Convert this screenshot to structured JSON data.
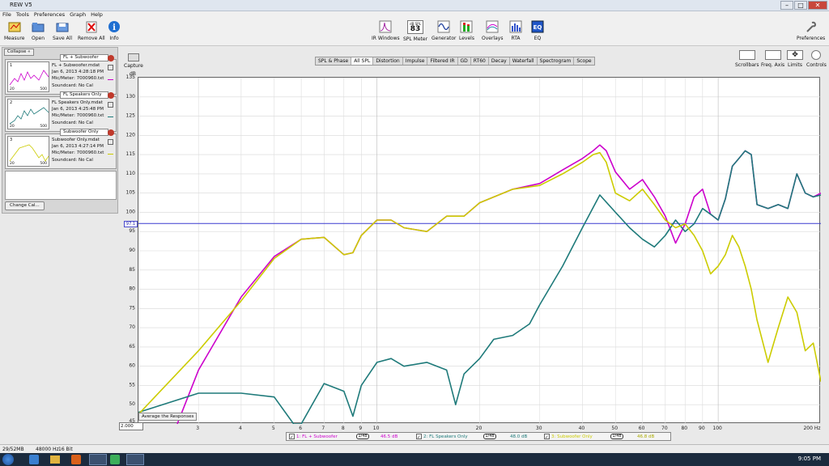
{
  "window": {
    "title": "REW V5"
  },
  "menu": [
    "File",
    "Tools",
    "Preferences",
    "Graph",
    "Help"
  ],
  "toolbar_left": [
    {
      "label": "Measure",
      "icon": "measure-icon"
    },
    {
      "label": "Open",
      "icon": "open-folder-icon"
    },
    {
      "label": "Save All",
      "icon": "save-icon"
    },
    {
      "label": "Remove All",
      "icon": "remove-icon"
    },
    {
      "label": "Info",
      "icon": "info-icon"
    }
  ],
  "toolbar_center": [
    {
      "label": "IR Windows",
      "icon": "ir-windows-icon"
    },
    {
      "label": "SPL Meter",
      "icon": "spl-meter-icon",
      "readout_unit": "dB SPL",
      "readout_value": "83"
    },
    {
      "label": "Generator",
      "icon": "generator-icon"
    },
    {
      "label": "Levels",
      "icon": "levels-icon"
    },
    {
      "label": "Overlays",
      "icon": "overlays-icon"
    },
    {
      "label": "RTA",
      "icon": "rta-icon"
    },
    {
      "label": "EQ",
      "icon": "eq-icon"
    }
  ],
  "toolbar_right": {
    "label": "Preferences",
    "icon": "wrench-icon"
  },
  "graph_tabs": {
    "items": [
      "SPL & Phase",
      "All SPL",
      "Distortion",
      "Impulse",
      "Filtered IR",
      "GD",
      "RT60",
      "Decay",
      "Waterfall",
      "Spectrogram",
      "Scope"
    ],
    "active": "All SPL"
  },
  "right_controls": [
    "Scrollbars",
    "Freq. Axis",
    "Limits",
    "Controls"
  ],
  "capture": {
    "label": "Capture"
  },
  "left_panel": {
    "collapse_label": "Collapse",
    "change_cal_label": "Change Cal...",
    "measurements": [
      {
        "num": "1",
        "tag": "FL + Subwoofer",
        "lines": [
          "FL + Subwoofer.mdat",
          "Jan 6, 2013 4:28:18 PM",
          "Mic/Meter: 7000960.txt",
          "Soundcard: No Cal"
        ],
        "color": "#cc00cc",
        "mini_min": "20",
        "mini_max": "500"
      },
      {
        "num": "2",
        "tag": "FL Speakers Only",
        "lines": [
          "FL Speakers Only.mdat",
          "Jan 6, 2013 4:25:48 PM",
          "Mic/Meter: 7000960.txt",
          "Soundcard: No Cal"
        ],
        "color": "#1e7a7a",
        "mini_min": "20",
        "mini_max": "500"
      },
      {
        "num": "3",
        "tag": "Subwoofer Only",
        "lines": [
          "Subwoofer Only.mdat",
          "Jan 6, 2013 4:27:14 PM",
          "Mic/Meter: 7000960.txt",
          "Soundcard: No Cal"
        ],
        "color": "#cccc00",
        "mini_min": "20",
        "mini_max": "500"
      }
    ]
  },
  "legend": [
    {
      "label": "1: FL + Subwoofer",
      "value": "46.5 dB",
      "smoothing": "1/48",
      "color": "#cc00cc"
    },
    {
      "label": "2: FL Speakers Only",
      "value": "48.0 dB",
      "smoothing": "1/48",
      "color": "#1e7a7a"
    },
    {
      "label": "3: Subwoofer Only",
      "value": "46.8 dB",
      "smoothing": "1/48",
      "color": "#cccc00"
    }
  ],
  "average_button": "Average the Responses",
  "x_min_input": "2.000",
  "y_marker": "97.1",
  "status": {
    "memory": "29/52MB",
    "rate": "48000 Hz",
    "bits": "16 Bit"
  },
  "taskbar": {
    "time": "9:05 PM"
  },
  "chart_data": {
    "type": "line",
    "ylabel": "dB",
    "xlabel": "Hz",
    "x_scale": "log",
    "xlim": [
      2,
      200
    ],
    "ylim": [
      45,
      135
    ],
    "y_ticks": [
      50,
      55,
      60,
      65,
      70,
      75,
      80,
      85,
      90,
      95,
      100,
      105,
      110,
      115,
      120,
      125,
      130,
      135
    ],
    "y_tick_bottom": "45",
    "x_ticks": [
      {
        "v": 3,
        "l": "3"
      },
      {
        "v": 4,
        "l": "4"
      },
      {
        "v": 5,
        "l": "5"
      },
      {
        "v": 6,
        "l": "6"
      },
      {
        "v": 7,
        "l": "7"
      },
      {
        "v": 8,
        "l": "8"
      },
      {
        "v": 9,
        "l": "9"
      },
      {
        "v": 10,
        "l": "10"
      },
      {
        "v": 20,
        "l": "20"
      },
      {
        "v": 30,
        "l": "30"
      },
      {
        "v": 40,
        "l": "40"
      },
      {
        "v": 50,
        "l": "50"
      },
      {
        "v": 60,
        "l": "60"
      },
      {
        "v": 70,
        "l": "70"
      },
      {
        "v": 80,
        "l": "80"
      },
      {
        "v": 90,
        "l": "90"
      },
      {
        "v": 100,
        "l": "100"
      },
      {
        "v": 200,
        "l": "200 Hz"
      }
    ],
    "ref_line": 97.1,
    "grid": true,
    "series": [
      {
        "name": "1: FL + Subwoofer",
        "color": "#cc00cc",
        "x": [
          2.6,
          3,
          4,
          5,
          6,
          7,
          8,
          8.5,
          9,
          10,
          11,
          12,
          14,
          16,
          18,
          20,
          25,
          30,
          35,
          40,
          43,
          45,
          47,
          50,
          55,
          60,
          65,
          70,
          75,
          80,
          85,
          90,
          95,
          100,
          105,
          110,
          115,
          120,
          125,
          130,
          140,
          150,
          160,
          170,
          180,
          190,
          200
        ],
        "y": [
          45,
          59,
          78,
          88.5,
          93,
          93.5,
          89,
          89.5,
          94,
          98,
          98,
          96,
          95,
          99,
          99,
          102.5,
          106,
          107.5,
          111,
          114,
          116,
          117.5,
          116,
          110.5,
          106,
          108.5,
          104,
          99,
          92,
          97,
          104,
          106,
          99.5,
          98,
          103.5,
          112,
          114,
          116,
          115,
          102,
          101,
          102,
          101,
          110,
          105,
          104,
          105
        ]
      },
      {
        "name": "2: FL Speakers Only",
        "color": "#1e7a7a",
        "x": [
          2,
          3,
          4,
          5,
          5.7,
          6,
          7,
          8,
          8.5,
          9,
          10,
          11,
          12,
          14,
          16,
          17,
          18,
          20,
          22,
          25,
          28,
          30,
          35,
          40,
          45,
          50,
          55,
          60,
          65,
          70,
          75,
          80,
          85,
          90,
          95,
          100,
          105,
          110,
          115,
          120,
          125,
          130,
          140,
          150,
          160,
          170,
          180,
          190,
          200
        ],
        "y": [
          48,
          53,
          53,
          52,
          45,
          45,
          55.5,
          53.5,
          47,
          55,
          61,
          62,
          60,
          61,
          59,
          50,
          58,
          62,
          67,
          68,
          71,
          76,
          86,
          96,
          104.5,
          100,
          96,
          93,
          91,
          94,
          98,
          95,
          97,
          101,
          99.5,
          98,
          103.5,
          112,
          114,
          116,
          115,
          102,
          101,
          102,
          101,
          110,
          105,
          104,
          104.5
        ]
      },
      {
        "name": "3: Subwoofer Only",
        "color": "#cccc00",
        "x": [
          2,
          3,
          4,
          5,
          6,
          7,
          8,
          8.5,
          9,
          10,
          11,
          12,
          14,
          16,
          18,
          20,
          25,
          30,
          35,
          40,
          43,
          45,
          47,
          50,
          55,
          60,
          65,
          70,
          75,
          80,
          85,
          90,
          95,
          100,
          105,
          110,
          115,
          120,
          125,
          130,
          140,
          150,
          160,
          170,
          180,
          190,
          200
        ],
        "y": [
          47.5,
          64,
          77,
          88,
          93,
          93.5,
          89,
          89.5,
          94,
          98,
          98,
          96,
          95,
          99,
          99,
          102.5,
          106,
          107,
          110,
          113,
          115,
          115.5,
          113,
          105,
          103,
          106,
          102,
          98,
          96,
          97,
          94,
          90,
          84,
          86,
          89,
          94,
          91,
          86,
          80,
          72,
          61,
          70,
          78,
          74,
          64,
          66,
          56
        ]
      }
    ]
  }
}
